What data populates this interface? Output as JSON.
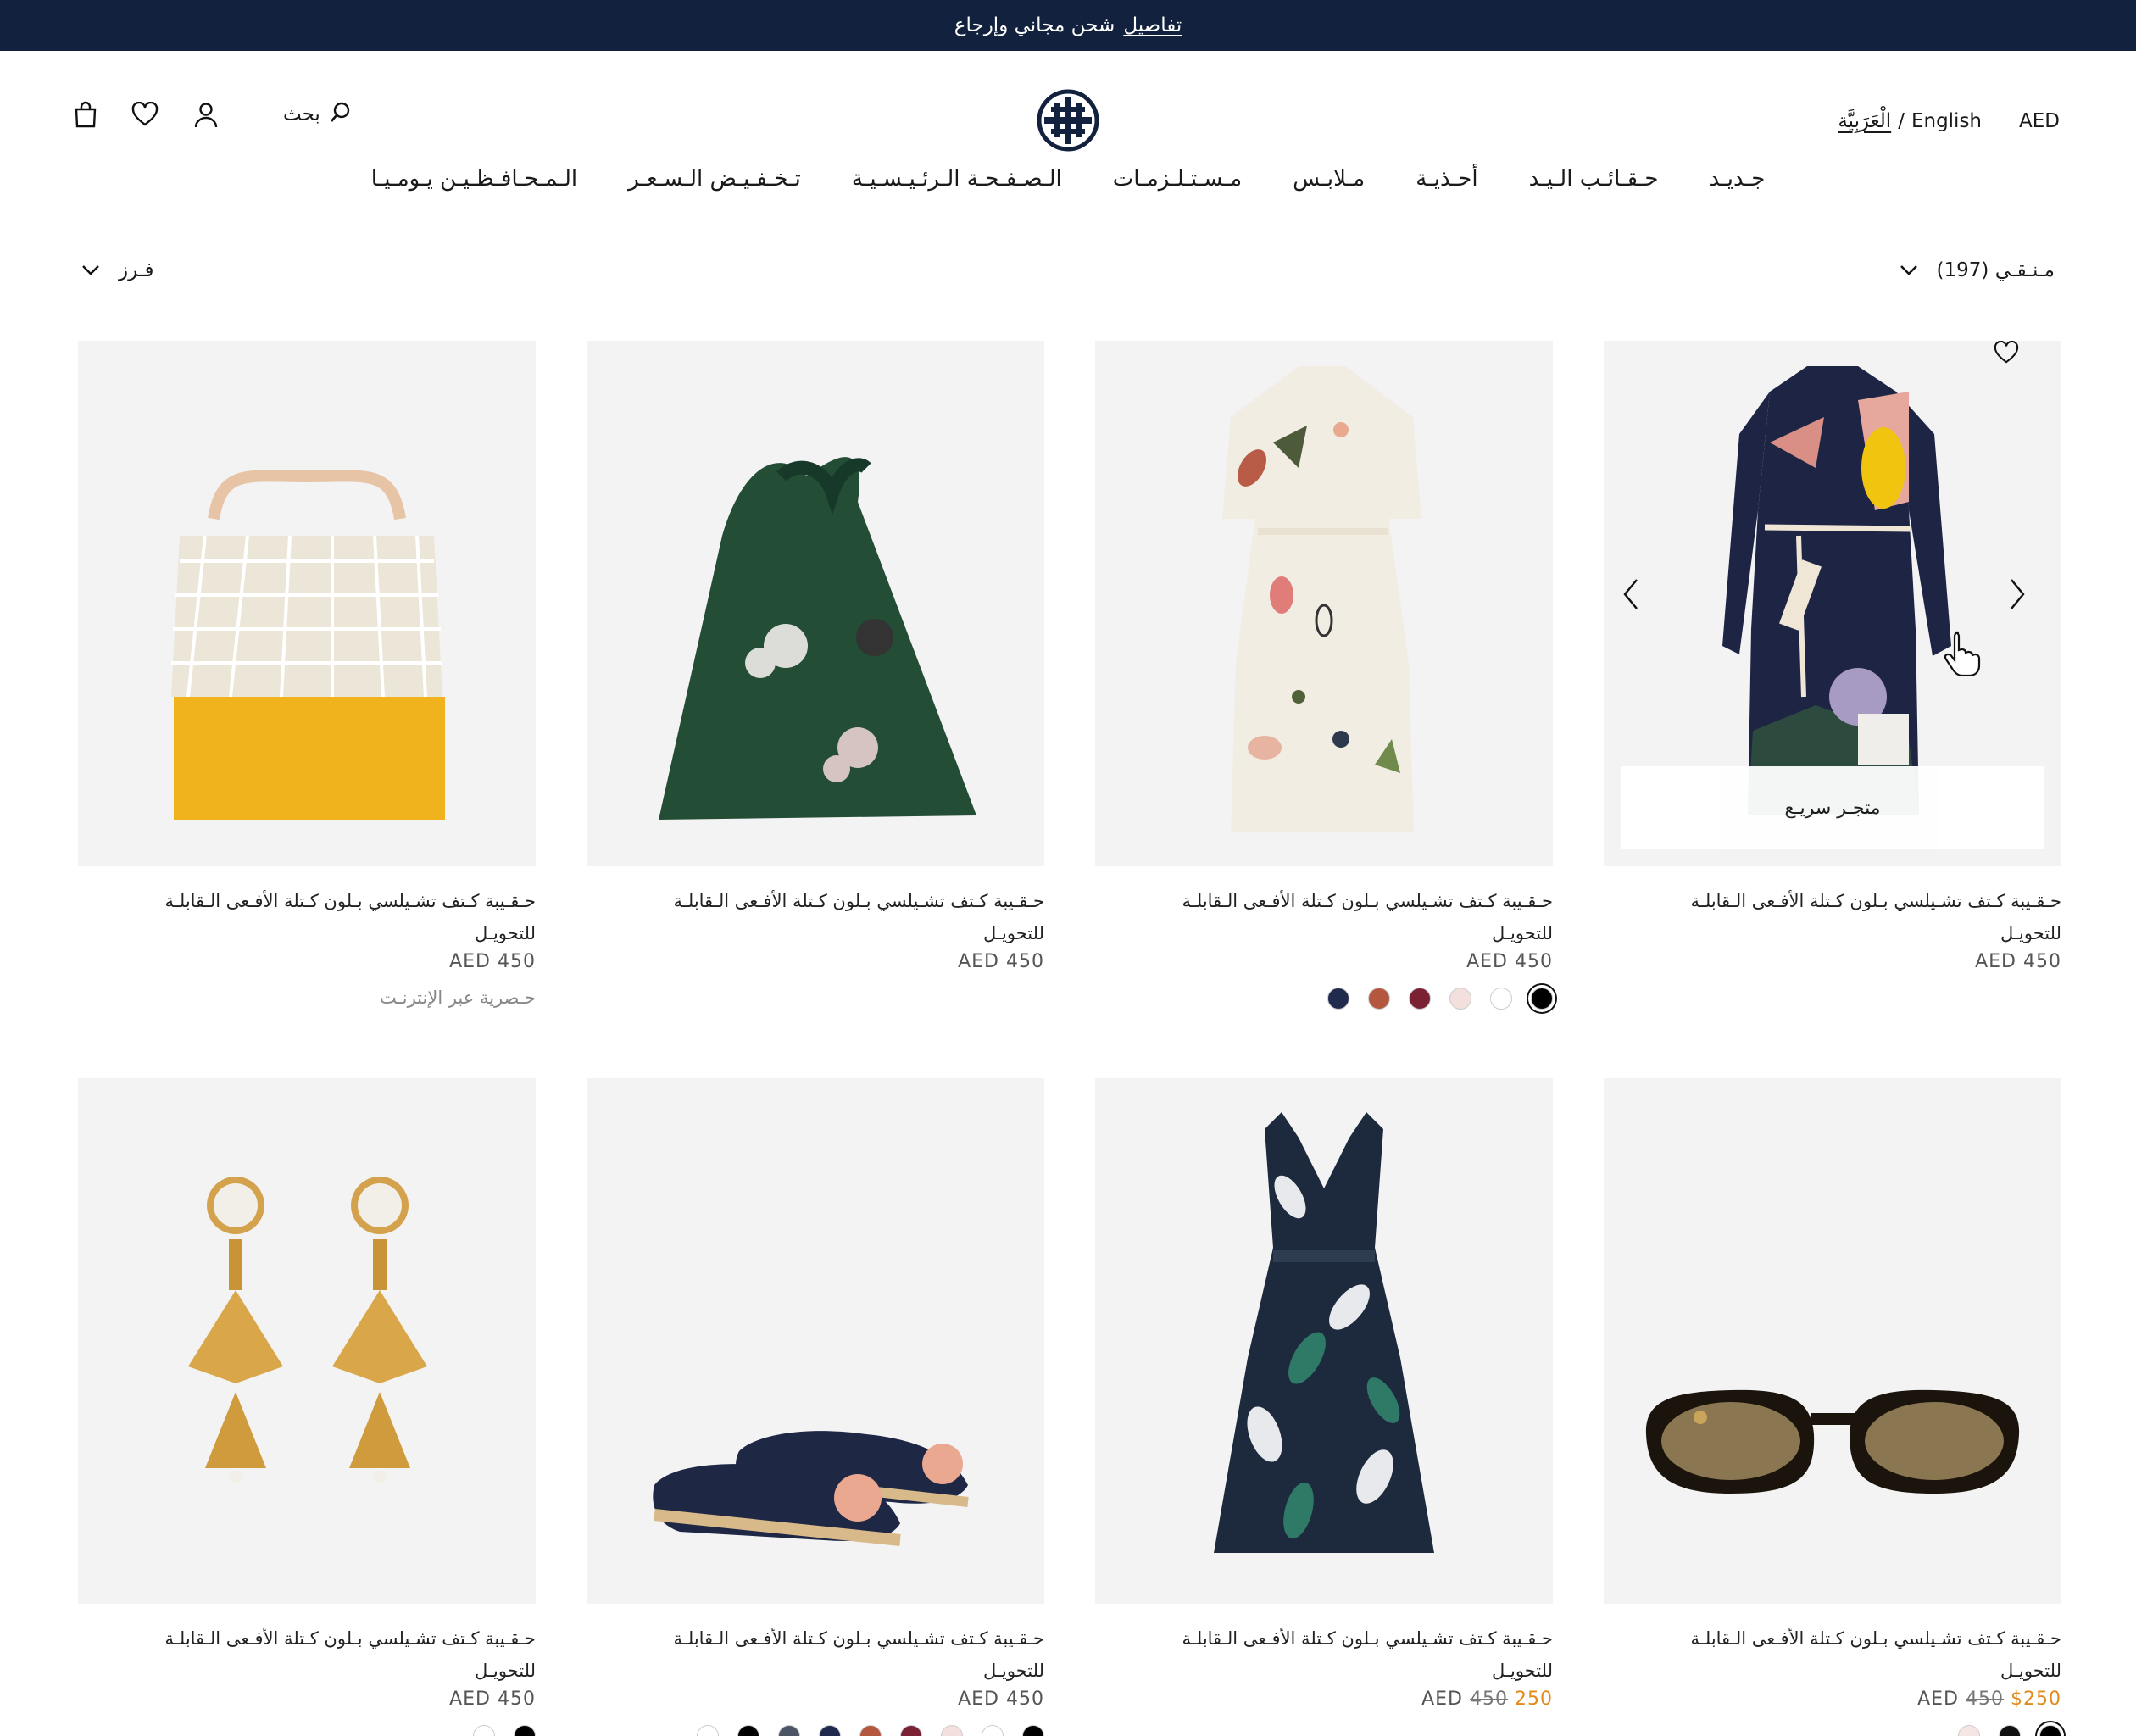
{
  "announcement": {
    "details": "تفاصيل",
    "text": "شحن مجاني وإرجاع"
  },
  "header": {
    "search_label": "بحث",
    "currency": "AED",
    "lang_english": "English",
    "lang_sep": "/",
    "lang_arabic": "الْعَرَبِيَّة"
  },
  "nav": [
    "جـديـد",
    "حـقـائـب الـيـد",
    "أحـذيـة",
    "مـلابـس",
    "مـسـتـلـزمـات",
    "الـصـفـحـة الـرئـيـسـيـة",
    "تـخـفـيـض الـسـعـر",
    "الـمـحـافـظـيـن يـومـيـا"
  ],
  "toolbar": {
    "filter_label": "مـنـقـي (197)",
    "sort_label": "فـرز"
  },
  "products": [
    {
      "name": "حـقـيبة كـتف تشـيلسي بـلون كـتلة الأفـعى الـقابلـة للتحويـل",
      "currency": "AED",
      "price": "450",
      "old_price": "",
      "sale_price": "",
      "note": "",
      "quick_shop": "متجـر سريـع",
      "image": "dress-navy-icon",
      "swatches": [],
      "active": true
    },
    {
      "name": "حـقـيبة كـتف تشـيلسي بـلون كـتلة الأفـعى الـقابلـة للتحويـل",
      "currency": "AED",
      "price": "450",
      "old_price": "",
      "sale_price": "",
      "note": "",
      "image": "dress-white-icon",
      "swatches": [
        "#000000",
        "#ffffff",
        "#f3dfdb",
        "#7a2233",
        "#b5573e",
        "#1f2a4d"
      ]
    },
    {
      "name": "حـقـيبة كـتف تشـيلسي بـلون كـتلة الأفـعى الـقابلـة للتحويـل",
      "currency": "AED",
      "price": "450",
      "old_price": "",
      "sale_price": "",
      "note": "",
      "image": "green-bag-icon",
      "swatches": []
    },
    {
      "name": "حـقـيبة كـتف تشـيلسي بـلون كـتلة الأفـعى الـقابلـة للتحويـل",
      "currency": "AED",
      "price": "450",
      "old_price": "",
      "sale_price": "",
      "note": "حـصرية عبر الإنترنـت",
      "image": "net-tote-icon",
      "swatches": []
    },
    {
      "name": "حـقـيبة كـتف تشـيلسي بـلون كـتلة الأفـعى الـقابلـة للتحويـل",
      "currency": "AED",
      "price": "",
      "old_price": "450",
      "sale_price": "$250",
      "note": "",
      "image": "sunglasses-icon",
      "swatches": [
        "#000000",
        "#111111",
        "#f5e6e3"
      ]
    },
    {
      "name": "حـقـيبة كـتف تشـيلسي بـلون كـتلة الأفـعى الـقابلـة للتحويـل",
      "currency": "AED",
      "price": "",
      "old_price": "450",
      "sale_price": "250",
      "note": "",
      "image": "floral-dress-icon",
      "swatches": []
    },
    {
      "name": "حـقـيبة كـتف تشـيلسي بـلون كـتلة الأفـعى الـقابلـة للتحويـل",
      "currency": "AED",
      "price": "450",
      "old_price": "",
      "sale_price": "",
      "note": "",
      "image": "espadrilles-icon",
      "swatches": [
        "#000000",
        "#ffffff",
        "#f3dfdb",
        "#7a2233",
        "#b5573e",
        "#1f2a4d",
        "#4b5566",
        "#000000",
        "#ffffff"
      ]
    },
    {
      "name": "حـقـيبة كـتف تشـيلسي بـلون كـتلة الأفـعى الـقابلـة للتحويـل",
      "currency": "AED",
      "price": "450",
      "old_price": "",
      "sale_price": "",
      "note": "",
      "image": "earrings-icon",
      "swatches": [
        "#000000",
        "#ffffff"
      ]
    }
  ]
}
